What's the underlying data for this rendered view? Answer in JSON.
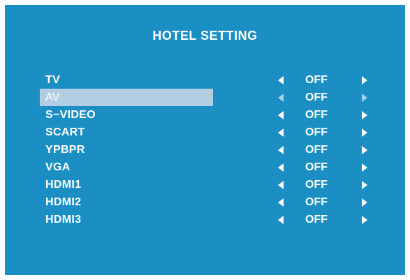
{
  "menu": {
    "title": "HOTEL SETTING",
    "items": [
      {
        "label": "TV",
        "value": "OFF",
        "selected": false
      },
      {
        "label": "AV",
        "value": "OFF",
        "selected": true
      },
      {
        "label": "S−VIDEO",
        "value": "OFF",
        "selected": false
      },
      {
        "label": "SCART",
        "value": "OFF",
        "selected": false
      },
      {
        "label": "YPBPR",
        "value": "OFF",
        "selected": false
      },
      {
        "label": "VGA",
        "value": "OFF",
        "selected": false
      },
      {
        "label": "HDMI1",
        "value": "OFF",
        "selected": false
      },
      {
        "label": "HDMI2",
        "value": "OFF",
        "selected": false
      },
      {
        "label": "HDMI3",
        "value": "OFF",
        "selected": false
      }
    ]
  },
  "colors": {
    "background": "#1b8fc4",
    "highlight": "#b3cde3",
    "text": "#ffffff"
  }
}
